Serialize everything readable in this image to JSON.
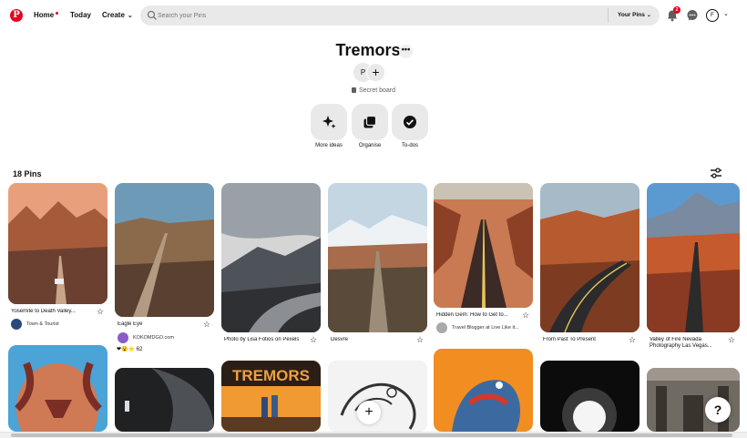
{
  "header": {
    "logo": "P",
    "nav": {
      "home": "Home",
      "today": "Today",
      "create": "Create"
    },
    "search_placeholder": "Search your Pins",
    "your_pins": "Your Pins",
    "notification_count": "2",
    "account_initial": "F",
    "icons": {
      "search": "search-icon",
      "bell": "bell-icon",
      "chat": "chat-icon",
      "chevron": "chevron-down-icon"
    }
  },
  "board": {
    "title": "Tremors",
    "more": "•••",
    "collaborator_initial": "P",
    "add_collaborator": "+",
    "privacy": "Secret board",
    "actions": [
      {
        "label": "More ideas",
        "icon": "sparkle-icon"
      },
      {
        "label": "Organise",
        "icon": "organise-icon"
      },
      {
        "label": "To-dos",
        "icon": "check-icon"
      }
    ],
    "pins_count": "18 Pins"
  },
  "pins": [
    {
      "title": "Yosemite to Death Valley...",
      "source": "Town & Tourist",
      "colors": [
        "#d98a5f",
        "#7b4a36",
        "#3c2a24"
      ]
    },
    {
      "title": "Eagle Eye",
      "source": "KOKOMDGO.com",
      "reactions": "❤😮⭐",
      "reaction_count": "62",
      "colors": [
        "#6d9bb7",
        "#8a6a4a",
        "#5a4030"
      ]
    },
    {
      "title": "Photo by Lisa Fotios on Pexels",
      "colors": [
        "#c9c9c9",
        "#5c6168",
        "#2f3034"
      ]
    },
    {
      "title": "Desvre",
      "colors": [
        "#bcd0df",
        "#a86b4b",
        "#5a4a3a"
      ]
    },
    {
      "title": "Hidden Gem: How to Get to...",
      "source": "Travel Blogger at Live Like it...",
      "colors": [
        "#c97a52",
        "#8c4127",
        "#3b2a26"
      ]
    },
    {
      "title": "From Past To Present",
      "colors": [
        "#a7bac7",
        "#b65a2f",
        "#2b2b2e"
      ]
    },
    {
      "title": "Valley of Fire Nevada Photography Las Vegas...",
      "colors": [
        "#5b9ad0",
        "#c55a2c",
        "#2b2b2b"
      ]
    },
    {
      "title": "",
      "colors": [
        "#4ba3d6",
        "#cf7a55",
        "#7a2e25"
      ]
    },
    {
      "title": "",
      "colors": [
        "#2a2c2e",
        "#4d5155",
        "#111"
      ]
    },
    {
      "title": "",
      "label": "TREMORS",
      "colors": [
        "#2b1e16",
        "#d3741e",
        "#f09a33"
      ]
    },
    {
      "title": "",
      "add": "+",
      "colors": [
        "#ffffff",
        "#dddddd",
        "#333333"
      ]
    },
    {
      "title": "",
      "colors": [
        "#f28d22",
        "#3c6aa0",
        "#d13a2a"
      ]
    },
    {
      "title": "",
      "colors": [
        "#0c0c0c",
        "#3a3a3a",
        "#f5f5f5"
      ]
    },
    {
      "title": "",
      "colors": [
        "#6f6a62",
        "#3a342f",
        "#9d968c"
      ]
    }
  ],
  "help": "?"
}
